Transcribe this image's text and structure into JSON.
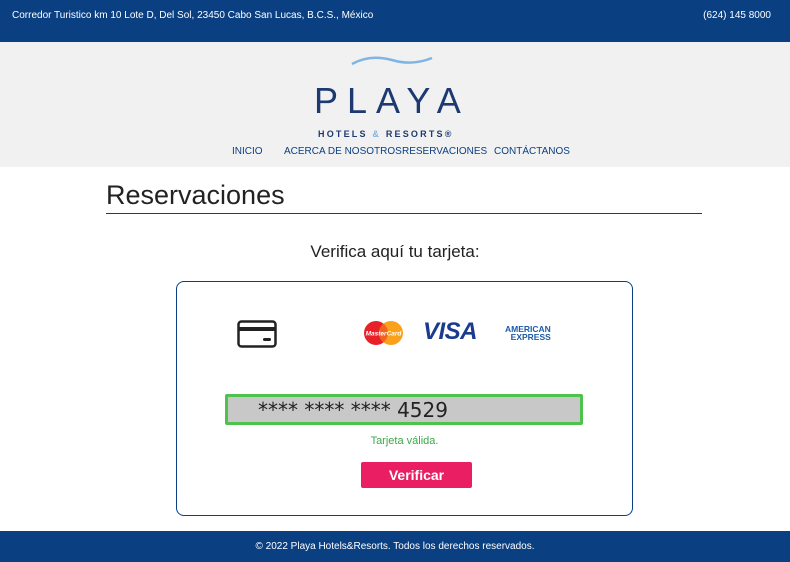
{
  "topbar": {
    "address": "Corredor Turistico km 10 Lote D, Del Sol, 23450 Cabo San Lucas, B.C.S., México",
    "phone": "(624) 145 8000"
  },
  "logo": {
    "word": "PLAYA",
    "sub_left": "HOTELS",
    "sub_amp": "&",
    "sub_right": "RESORTS®"
  },
  "nav": {
    "items": [
      "INICIO",
      "ACERCA DE NOSOTROS",
      "RESERVACIONES",
      "CONTÁCTANOS"
    ]
  },
  "main": {
    "title": "Reservaciones",
    "subtitle": "Verifica aquí tu tarjeta:",
    "card_input_value": "**** **** **** 4529",
    "valid_message": "Tarjeta válida.",
    "verify_label": "Verificar",
    "brands": {
      "mastercard": "MasterCard",
      "visa": "VISA",
      "amex_line1": "AMERICAN",
      "amex_line2": "EXPRESS"
    }
  },
  "footer": {
    "text": "© 2022 Playa Hotels&Resorts. Todos los derechos reservados."
  },
  "colors": {
    "navy": "#0a3f82",
    "header_bg": "#f2f1f1",
    "accent_pink": "#e91e63",
    "valid_green": "#4dc24d"
  }
}
